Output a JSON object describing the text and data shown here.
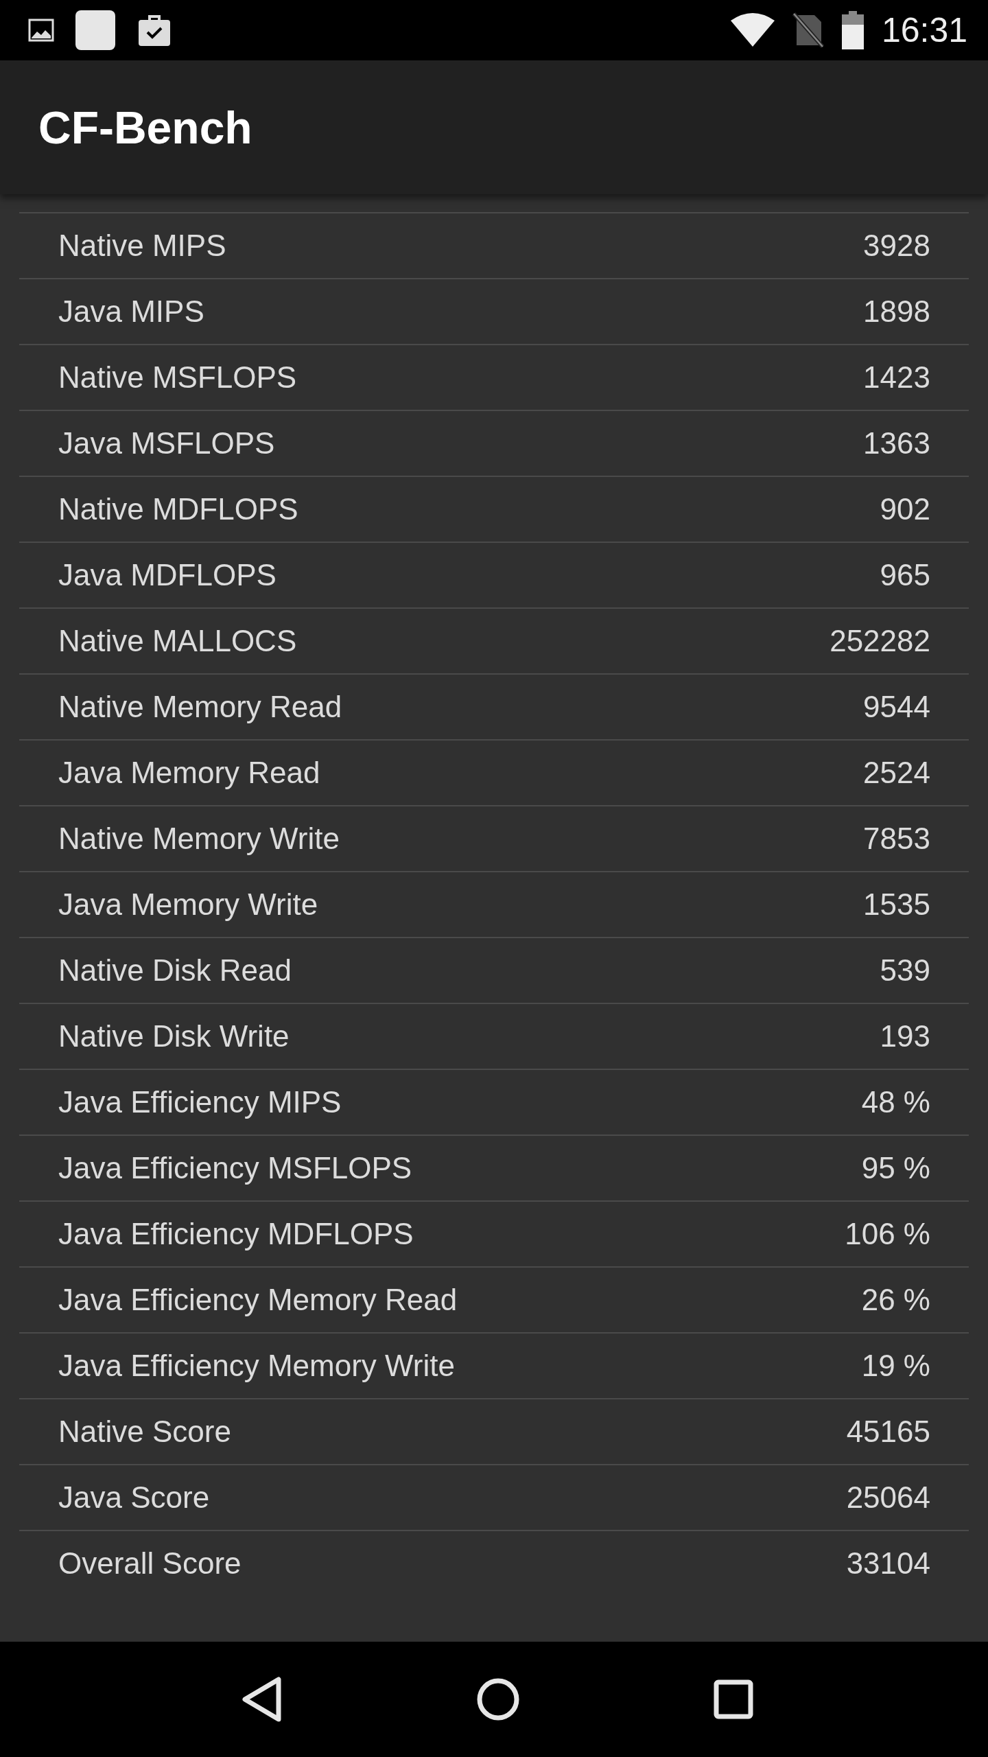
{
  "status_bar": {
    "time": "16:31"
  },
  "app_bar": {
    "title": "CF-Bench"
  },
  "results": [
    {
      "label": "Native MIPS",
      "value": "3928"
    },
    {
      "label": "Java MIPS",
      "value": "1898"
    },
    {
      "label": "Native MSFLOPS",
      "value": "1423"
    },
    {
      "label": "Java MSFLOPS",
      "value": "1363"
    },
    {
      "label": "Native MDFLOPS",
      "value": "902"
    },
    {
      "label": "Java MDFLOPS",
      "value": "965"
    },
    {
      "label": "Native MALLOCS",
      "value": "252282"
    },
    {
      "label": "Native Memory Read",
      "value": "9544"
    },
    {
      "label": "Java Memory Read",
      "value": "2524"
    },
    {
      "label": "Native Memory Write",
      "value": "7853"
    },
    {
      "label": "Java Memory Write",
      "value": "1535"
    },
    {
      "label": "Native Disk Read",
      "value": "539"
    },
    {
      "label": "Native Disk Write",
      "value": "193"
    },
    {
      "label": "Java Efficiency MIPS",
      "value": "48 %"
    },
    {
      "label": "Java Efficiency MSFLOPS",
      "value": "95 %"
    },
    {
      "label": "Java Efficiency MDFLOPS",
      "value": "106 %"
    },
    {
      "label": "Java Efficiency Memory Read",
      "value": "26 %"
    },
    {
      "label": "Java Efficiency Memory Write",
      "value": "19 %"
    },
    {
      "label": "Native Score",
      "value": "45165"
    },
    {
      "label": "Java Score",
      "value": "25064"
    },
    {
      "label": "Overall Score",
      "value": "33104"
    }
  ]
}
